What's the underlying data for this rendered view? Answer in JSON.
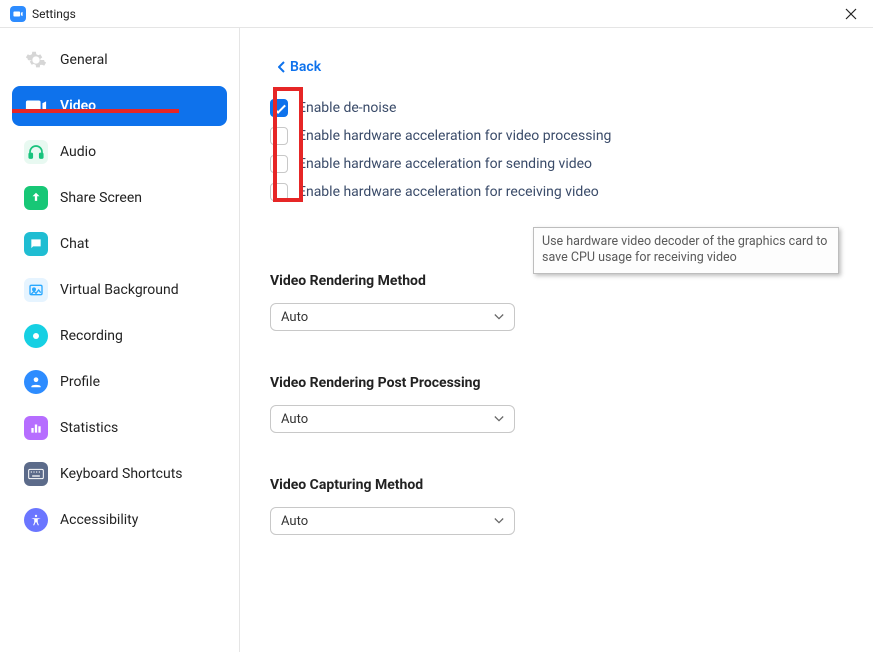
{
  "titlebar": {
    "title": "Settings"
  },
  "sidebar": {
    "items": [
      {
        "label": "General"
      },
      {
        "label": "Video"
      },
      {
        "label": "Audio"
      },
      {
        "label": "Share Screen"
      },
      {
        "label": "Chat"
      },
      {
        "label": "Virtual Background"
      },
      {
        "label": "Recording"
      },
      {
        "label": "Profile"
      },
      {
        "label": "Statistics"
      },
      {
        "label": "Keyboard Shortcuts"
      },
      {
        "label": "Accessibility"
      }
    ]
  },
  "content": {
    "back_label": "Back",
    "checkboxes": [
      {
        "label": "Enable de-noise",
        "checked": true
      },
      {
        "label": "Enable hardware acceleration for video processing",
        "checked": false
      },
      {
        "label": "Enable hardware acceleration for sending video",
        "checked": false
      },
      {
        "label": "Enable hardware acceleration for receiving video",
        "checked": false
      }
    ],
    "tooltip": "Use hardware video decoder of the graphics card to save CPU usage for receiving video",
    "sections": [
      {
        "title": "Video Rendering Method",
        "value": "Auto"
      },
      {
        "title": "Video Rendering Post Processing",
        "value": "Auto"
      },
      {
        "title": "Video Capturing Method",
        "value": "Auto"
      }
    ]
  },
  "colors": {
    "accent": "#0E72EC",
    "highlight": "#E62626"
  }
}
